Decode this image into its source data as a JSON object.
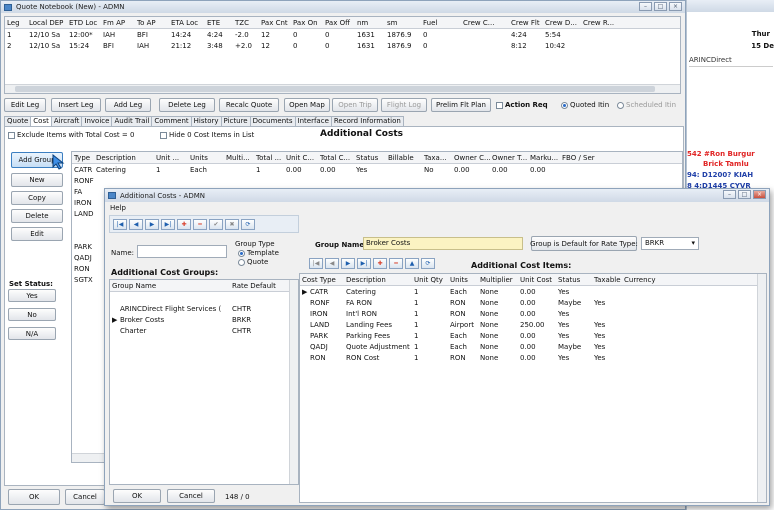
{
  "main_window": {
    "title": "Quote Notebook (New) - ADMN"
  },
  "legs": {
    "columns": [
      "Leg",
      "Local DEP",
      "ETD Loc",
      "Fm AP",
      "To AP",
      "ETA Loc",
      "ETE",
      "TZC",
      "Pax Cnt",
      "Pax On",
      "Pax Off",
      "nm",
      "sm",
      "Fuel",
      "Crew C...",
      "Crew Flt",
      "Crew D...",
      "Crew R..."
    ],
    "rows": [
      [
        "1",
        "12/10 Sa",
        "12:00*",
        "IAH",
        "BFI",
        "14:24",
        "4:24",
        "-2.0",
        "12",
        "0",
        "0",
        "1631",
        "1876.9",
        "0",
        "",
        "4:24",
        "5:54",
        ""
      ],
      [
        "2",
        "12/10 Sa",
        "15:24",
        "BFI",
        "IAH",
        "21:12",
        "3:48",
        "+2.0",
        "12",
        "0",
        "0",
        "1631",
        "1876.9",
        "0",
        "",
        "8:12",
        "10:42",
        ""
      ]
    ]
  },
  "toolbar": {
    "edit_leg": "Edit Leg",
    "insert_leg": "Insert Leg",
    "add_leg": "Add Leg",
    "delete_leg": "Delete Leg",
    "recalc_quote": "Recalc Quote",
    "open_map": "Open Map",
    "open_trip": "Open Trip",
    "flight_log": "Flight Log",
    "prelim_flt_plan": "Prelim Flt Plan",
    "action_req": "Action Req",
    "quoted_itin": "Quoted Itin",
    "scheduled_itin": "Scheduled Itin"
  },
  "tabs": [
    "Quote",
    "Cost",
    "Aircraft",
    "Invoice",
    "Audit Trail",
    "Comment",
    "History",
    "Picture",
    "Documents",
    "Interface",
    "Record Information"
  ],
  "cost_panel": {
    "exclude_label": "Exclude Items with Total Cost = 0",
    "hide_label": "Hide 0 Cost Items in List",
    "heading": "Additional Costs",
    "add_group": "Add Group",
    "new": "New",
    "copy": "Copy",
    "delete": "Delete",
    "edit": "Edit",
    "set_status": "Set Status:",
    "yes": "Yes",
    "no": "No",
    "na": "N/A",
    "columns": [
      "Type",
      "Description",
      "Unit ...",
      "Units",
      "Multi...",
      "Total ...",
      "Unit C...",
      "Total C...",
      "Status",
      "Billable",
      "Taxa...",
      "Owner C...",
      "Owner T...",
      "Marku...",
      "FBO / Ser"
    ],
    "rows": [
      [
        "CATR",
        "Catering",
        "1",
        "Each",
        "",
        "1",
        "0.00",
        "0.00",
        "Yes",
        "",
        "No",
        "0.00",
        "0.00",
        "0.00",
        ""
      ]
    ],
    "types": [
      "RONF",
      "FA",
      "IRON",
      "LAND",
      "PARK",
      "QADJ",
      "RON",
      "SGTX"
    ],
    "ok": "OK",
    "cancel": "Cancel"
  },
  "dialog": {
    "title": "Additional Costs - ADMN",
    "menu_help": "Help",
    "name_label": "Name:",
    "group_type_label": "Group Type",
    "template": "Template",
    "quote": "Quote",
    "groups_heading": "Additional Cost Groups:",
    "groups_columns": [
      "Group Name",
      "Rate Default"
    ],
    "groups": [
      [
        "",
        ""
      ],
      [
        "ARINCDirect Flight Services (",
        "CHTR"
      ],
      [
        "Broker Costs",
        "BRKR"
      ],
      [
        "Charter",
        "CHTR"
      ]
    ],
    "group_name_label": "Group Name:",
    "group_name_value": "Broker Costs",
    "default_button": "Group is Default for Rate Type:",
    "rate_type": "BRKR",
    "items_heading": "Additional Cost Items:",
    "items_columns": [
      "Cost Type",
      "Description",
      "Unit Qty",
      "Units",
      "Multiplier",
      "Unit Cost",
      "Status",
      "Taxable",
      "Currency"
    ],
    "items": [
      [
        "CATR",
        "Catering",
        "1",
        "Each",
        "None",
        "0.00",
        "Yes",
        "",
        ""
      ],
      [
        "RONF",
        "FA RON",
        "1",
        "RON",
        "None",
        "0.00",
        "Maybe",
        "Yes",
        ""
      ],
      [
        "IRON",
        "Int'l RON",
        "1",
        "RON",
        "None",
        "0.00",
        "Yes",
        "",
        ""
      ],
      [
        "LAND",
        "Landing Fees",
        "1",
        "Airport",
        "None",
        "250.00",
        "Yes",
        "Yes",
        ""
      ],
      [
        "PARK",
        "Parking Fees",
        "1",
        "Each",
        "None",
        "0.00",
        "Yes",
        "Yes",
        ""
      ],
      [
        "QADJ",
        "Quote Adjustment",
        "1",
        "Each",
        "None",
        "0.00",
        "Maybe",
        "Yes",
        ""
      ],
      [
        "RON",
        "RON Cost",
        "1",
        "RON",
        "None",
        "0.00",
        "Yes",
        "Yes",
        ""
      ]
    ],
    "ok": "OK",
    "cancel": "Cancel",
    "status": "148 / 0"
  },
  "right_panel": {
    "l1": "Thur",
    "l2": "15 De",
    "l3": "ARINCDirect",
    "l4": "542 #Ron Burgur",
    "l5": "Brick Tamlu",
    "l6": "94: D1200? KIAH",
    "l7": "8 4:D1445 CYVR"
  }
}
